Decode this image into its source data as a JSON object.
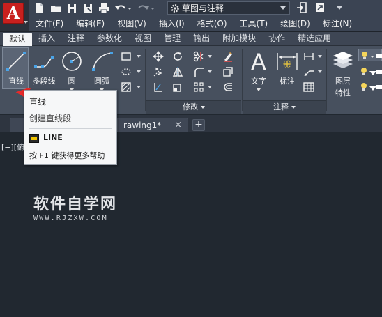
{
  "app": {
    "logo_letter": "A",
    "workspace": "草图与注释",
    "accent_color": "#c8201e"
  },
  "quick_access": {
    "icons": [
      "new-file-icon",
      "open-folder-icon",
      "save-icon",
      "save-as-icon",
      "print-icon",
      "undo-icon",
      "redo-icon"
    ]
  },
  "menubar": {
    "items": [
      "文件(F)",
      "编辑(E)",
      "视图(V)",
      "插入(I)",
      "格式(O)",
      "工具(T)",
      "绘图(D)",
      "标注(N)"
    ]
  },
  "ribbon_tabs": {
    "items": [
      "默认",
      "插入",
      "注释",
      "参数化",
      "视图",
      "管理",
      "输出",
      "附加模块",
      "协作",
      "精选应用"
    ],
    "active_index": 0
  },
  "draw_panel": {
    "line": "直线",
    "polyline": "多段线",
    "circle": "圆",
    "arc": "圆弧"
  },
  "modify_panel": {
    "footer": "修改"
  },
  "annotation_panel": {
    "text": "文字",
    "dimension": "标注",
    "footer": "注释"
  },
  "layers_panel": {
    "layer_properties_line1": "图层",
    "layer_properties_line2": "特性"
  },
  "doc_tabs": {
    "drawing": "rawing1*",
    "close": "×",
    "plus": "+"
  },
  "canvas": {
    "viewport_label": "[−][俯",
    "watermark_title": "软件自学网",
    "watermark_url": "WWW.RJZXW.COM"
  },
  "tooltip": {
    "title": "直线",
    "description": "创建直线段",
    "command": "LINE",
    "help": "按 F1 键获得更多帮助"
  }
}
